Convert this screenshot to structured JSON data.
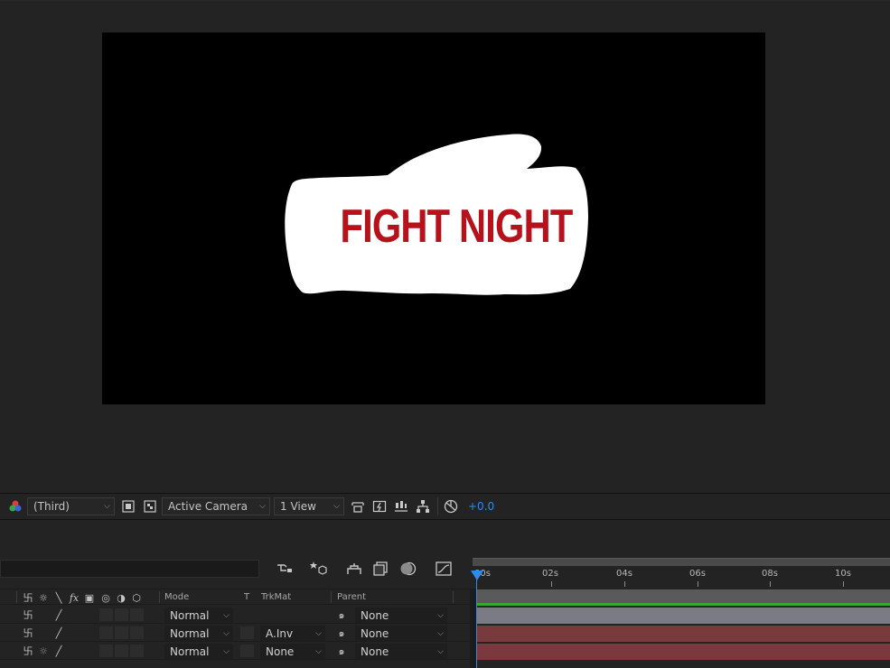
{
  "composition": {
    "title_text": "FIGHT NIGHT",
    "title_color": "#b5121b",
    "background_color": "#000000",
    "shape_color": "#ffffff",
    "shape_icon": "boxing-glove-shape"
  },
  "viewer_toolbar": {
    "channel_icon": "rgb-channels-icon",
    "resolution": "(Third)",
    "camera": "Active Camera",
    "views": "1 View",
    "exposure": "+0.0"
  },
  "timeline": {
    "ruler": [
      "00s",
      "02s",
      "04s",
      "06s",
      "08s",
      "10s"
    ],
    "columns": {
      "mode": "Mode",
      "t": "T",
      "trkmat": "TrkMat",
      "parent": "Parent"
    },
    "layers": [
      {
        "mode": "Normal",
        "trkmat": "",
        "parent": "None",
        "bar_color": "#7b7b86"
      },
      {
        "mode": "Normal",
        "trkmat": "A.Inv",
        "parent": "None",
        "bar_color": "#7a3a3d"
      },
      {
        "mode": "Normal",
        "trkmat": "None",
        "parent": "None",
        "bar_color": "#7a3a3d"
      }
    ],
    "accent_color": "#2d8ceb"
  }
}
